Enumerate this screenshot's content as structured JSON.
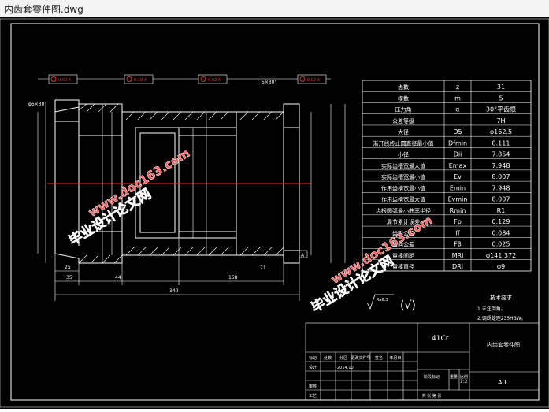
{
  "window": {
    "title": "内齿套零件图.dwg"
  },
  "watermark": {
    "text_cn": "毕业设计论文网",
    "text_url": "www.doc163.com"
  },
  "drawing": {
    "params_table": [
      {
        "name": "齿数",
        "symbol": "z",
        "value": "31"
      },
      {
        "name": "模数",
        "symbol": "m",
        "value": "5"
      },
      {
        "name": "压力角",
        "symbol": "α",
        "value": "30°平齿根"
      },
      {
        "name": "公差等级",
        "symbol": "",
        "value": "7H"
      },
      {
        "name": "大径",
        "symbol": "D5",
        "value": "φ162.5"
      },
      {
        "name": "渐开线终止圆直径最小值",
        "symbol": "Dfmin",
        "value": "8.111"
      },
      {
        "name": "小径",
        "symbol": "Dii",
        "value": "7.854"
      },
      {
        "name": "实际齿槽宽最大值",
        "symbol": "Emax",
        "value": "7.948"
      },
      {
        "name": "实际齿槽宽最小值",
        "symbol": "Ev",
        "value": "8.007"
      },
      {
        "name": "作用齿槽宽最小值",
        "symbol": "Emin",
        "value": "7.948"
      },
      {
        "name": "作用齿槽宽最大值",
        "symbol": "Evmin",
        "value": "8.007"
      },
      {
        "name": "齿根圆弧最小曲率半径",
        "symbol": "Rmin",
        "value": "R1"
      },
      {
        "name": "周节累计误差",
        "symbol": "Fp",
        "value": "0.129"
      },
      {
        "name": "齿形公差",
        "symbol": "ff",
        "value": "0.084"
      },
      {
        "name": "齿向公差",
        "symbol": "Fβ",
        "value": "0.025"
      },
      {
        "name": "量棒间距",
        "symbol": "MRi",
        "value": "φ141.372"
      },
      {
        "name": "量棒直径",
        "symbol": "DRi",
        "value": "φ9"
      }
    ],
    "tech_req": {
      "title": "技术要求",
      "items": [
        "1.未注倒角。",
        "2.调质处理235HBW。"
      ]
    },
    "roughness": "Ra6.3",
    "title_block": {
      "material": "41Cr",
      "part_name": "内齿套零件图",
      "scale": "1:2",
      "sheet": "A0",
      "labels": [
        "标记",
        "处数",
        "分区",
        "更改文件号",
        "签名",
        "年月日",
        "设计",
        "审核",
        "工艺",
        "阶段标记",
        "重量",
        "比例",
        "共 张 第 张"
      ],
      "date": "2014.10"
    },
    "dimensions": {
      "d1": "25",
      "d2": "35",
      "d3": "44",
      "d4": "158",
      "d5": "71",
      "total": "340",
      "angle": "5×30°",
      "chamfer": "φ5×30°"
    },
    "gdt": [
      "0.02 A",
      "0.19 A",
      "0.02 A",
      "0.02 A"
    ],
    "datum": "A"
  }
}
